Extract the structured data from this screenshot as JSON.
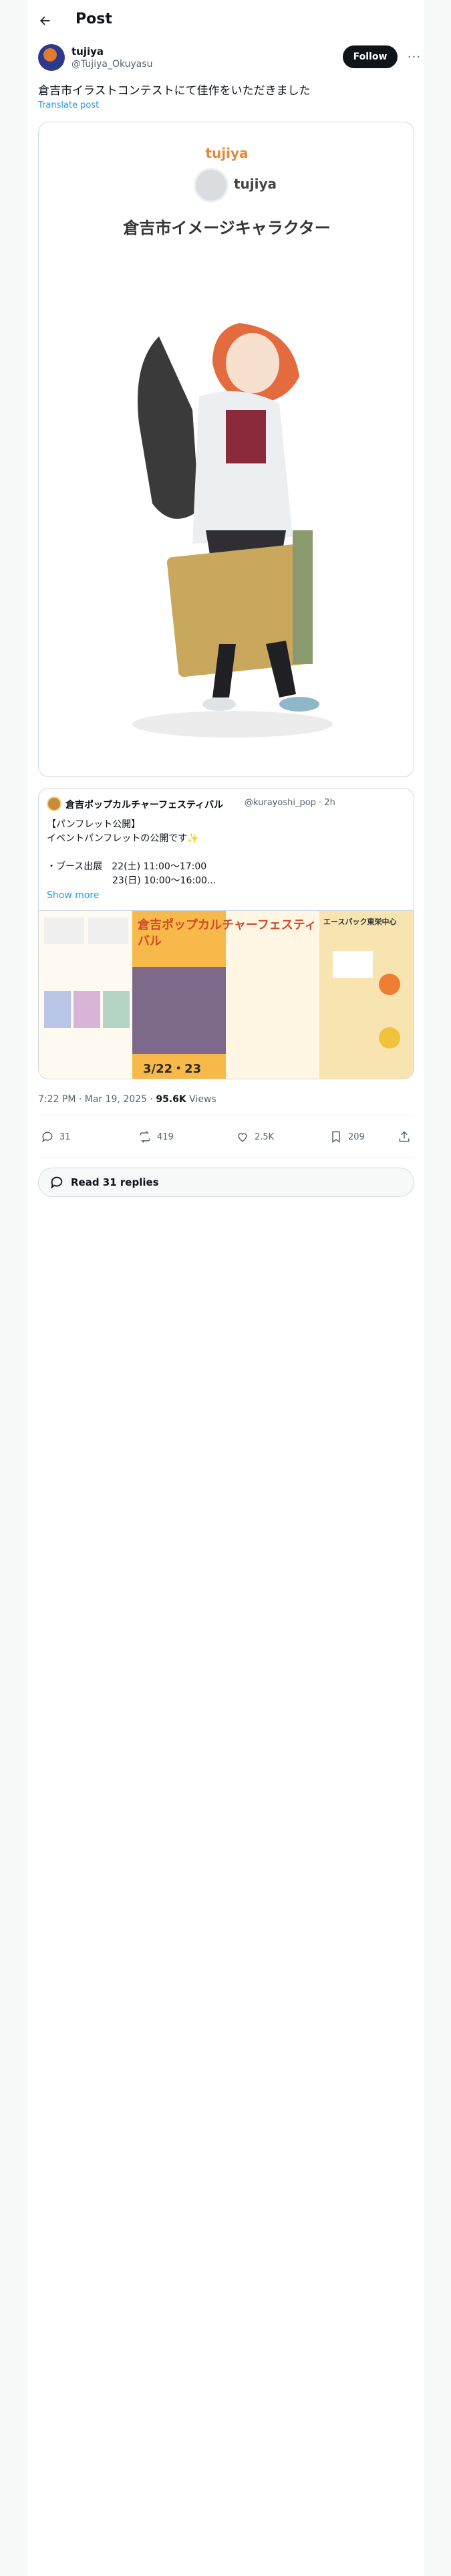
{
  "header": {
    "title": "Post"
  },
  "author": {
    "name": "tujiya",
    "handle": "@Tujiya_Okuyasu",
    "follow_label": "Follow",
    "more_label": "···"
  },
  "post": {
    "text": "倉吉市イラストコンテストにて佳作をいただきました",
    "translate_label": "Translate post"
  },
  "media": {
    "top_label": "tujiya",
    "badge_name": "tujiya",
    "caption": "倉吉市イメージキャラクター"
  },
  "quote": {
    "name": "倉吉ポップカルチャーフェスティバル",
    "handle": "@kurayoshi_pop · 2h",
    "body": "【パンフレット公開】\nイベントパンフレットの公開です✨\n\n・ブース出展　22(土) 11:00〜17:00\n　　　　　　　23(日) 10:00〜16:00...",
    "show_more": "Show more",
    "pamphlet_title": "倉吉ポップカルチャーフェスティバル",
    "pamphlet_dates": "3/22・23",
    "pamphlet_map_title": "エースパック東栄中心"
  },
  "meta": {
    "time": "7:22 PM · Mar 19, 2025 · ",
    "views_count": "95.6K",
    "views_label": " Views"
  },
  "actions": {
    "replies": "31",
    "reposts": "419",
    "likes": "2.5K",
    "bookmarks": "209"
  },
  "read_replies": "Read 31 replies",
  "colors": {
    "accent": "#1d9bf0",
    "text": "#0f1419",
    "muted": "#536471",
    "border": "#cfd9de"
  }
}
